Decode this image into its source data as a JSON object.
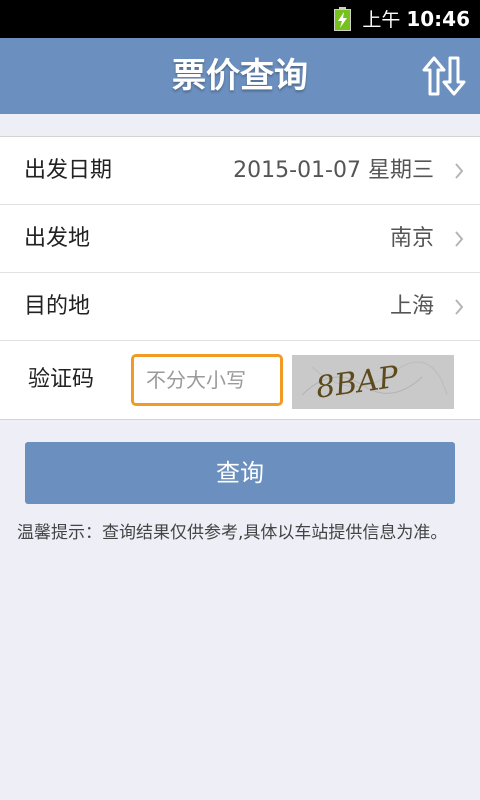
{
  "status_bar": {
    "ampm": "上午",
    "time": "10:46"
  },
  "header": {
    "title": "票价查询",
    "swap_icon": "swap-arrows-icon"
  },
  "form": {
    "rows": [
      {
        "label": "出发日期",
        "value": "2015-01-07 星期三"
      },
      {
        "label": "出发地",
        "value": "南京"
      },
      {
        "label": "目的地",
        "value": "上海"
      }
    ],
    "captcha": {
      "label": "验证码",
      "placeholder": "不分大小写",
      "value": "",
      "image_text": "8BAP"
    }
  },
  "actions": {
    "query_label": "查询"
  },
  "tip": "温馨提示：查询结果仅供参考,具体以车站提供信息为准。",
  "colors": {
    "accent": "#6b8fbe",
    "focus_border": "#f29b24",
    "background": "#eeeef7"
  }
}
